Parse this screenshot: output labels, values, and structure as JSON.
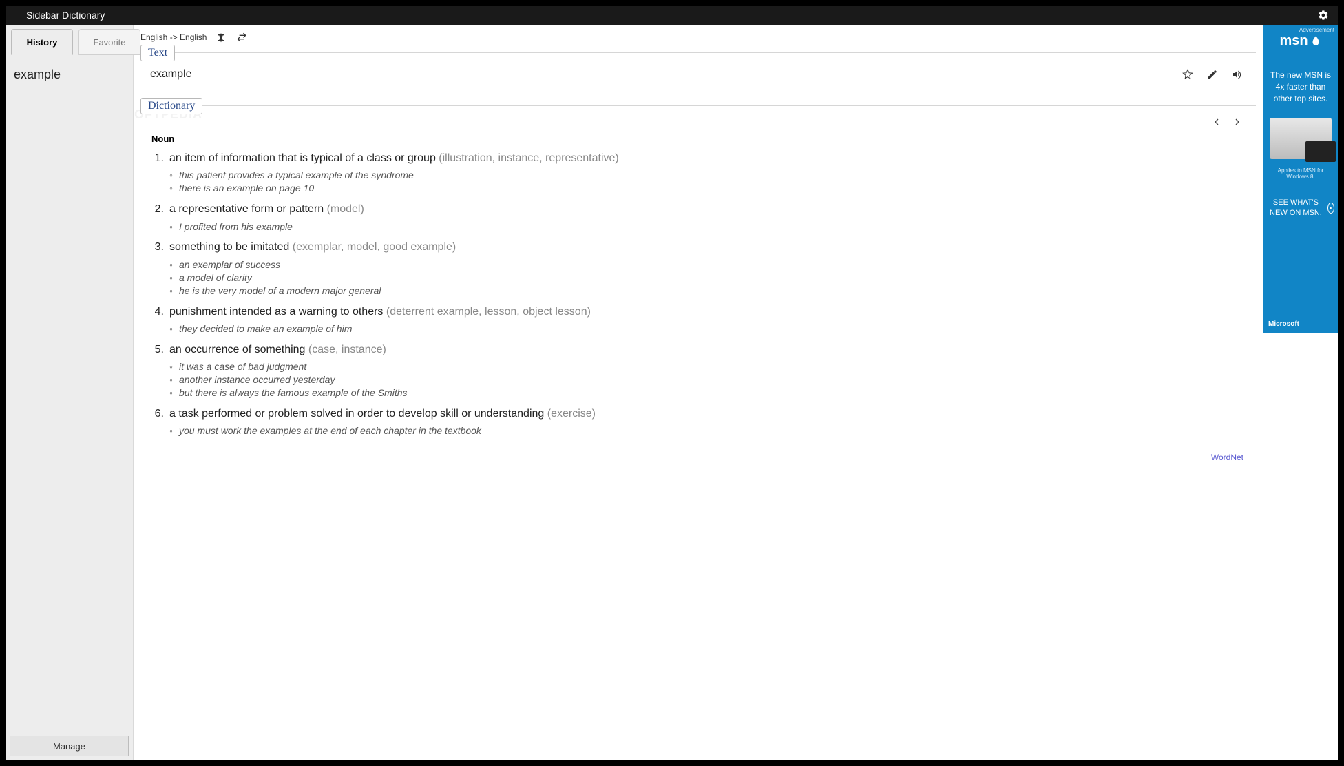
{
  "titlebar": {
    "title": "Sidebar Dictionary"
  },
  "sidebar": {
    "tabs": {
      "history": "History",
      "favorite": "Favorite"
    },
    "history_items": [
      "example"
    ],
    "manage": "Manage"
  },
  "langbar": {
    "pair": "English -> English"
  },
  "text_section": {
    "label": "Text",
    "word": "example"
  },
  "dict_section": {
    "label": "Dictionary",
    "pos": "Noun",
    "source": "WordNet",
    "defs": [
      {
        "n": "1.",
        "text": "an item of information that is typical of a class or group",
        "syn": "(illustration, instance, representative)",
        "ex": [
          "this patient provides a typical example of the syndrome",
          "there is an example on page 10"
        ]
      },
      {
        "n": "2.",
        "text": "a representative form or pattern",
        "syn": "(model)",
        "ex": [
          "I profited from his example"
        ]
      },
      {
        "n": "3.",
        "text": "something to be imitated",
        "syn": "(exemplar, model, good example)",
        "ex": [
          "an exemplar of success",
          "a model of clarity",
          "he is the very model of a modern major general"
        ]
      },
      {
        "n": "4.",
        "text": "punishment intended as a warning to others",
        "syn": "(deterrent example, lesson, object lesson)",
        "ex": [
          "they decided to make an example of him"
        ]
      },
      {
        "n": "5.",
        "text": "an occurrence of something",
        "syn": "(case, instance)",
        "ex": [
          "it was a case of bad judgment",
          "another instance occurred yesterday",
          "but there is always the famous example of the Smiths"
        ]
      },
      {
        "n": "6.",
        "text": "a task performed or problem solved in order to develop skill or understanding",
        "syn": "(exercise)",
        "ex": [
          "you must work the examples at the end of each chapter in the textbook"
        ]
      }
    ]
  },
  "ad": {
    "label": "Advertisement",
    "logo": "msn",
    "headline": "The new MSN is 4x faster than other top sites.",
    "small": "Applies to MSN for Windows 8.",
    "cta": "SEE WHAT'S NEW ON MSN.",
    "footer": "Microsoft"
  }
}
